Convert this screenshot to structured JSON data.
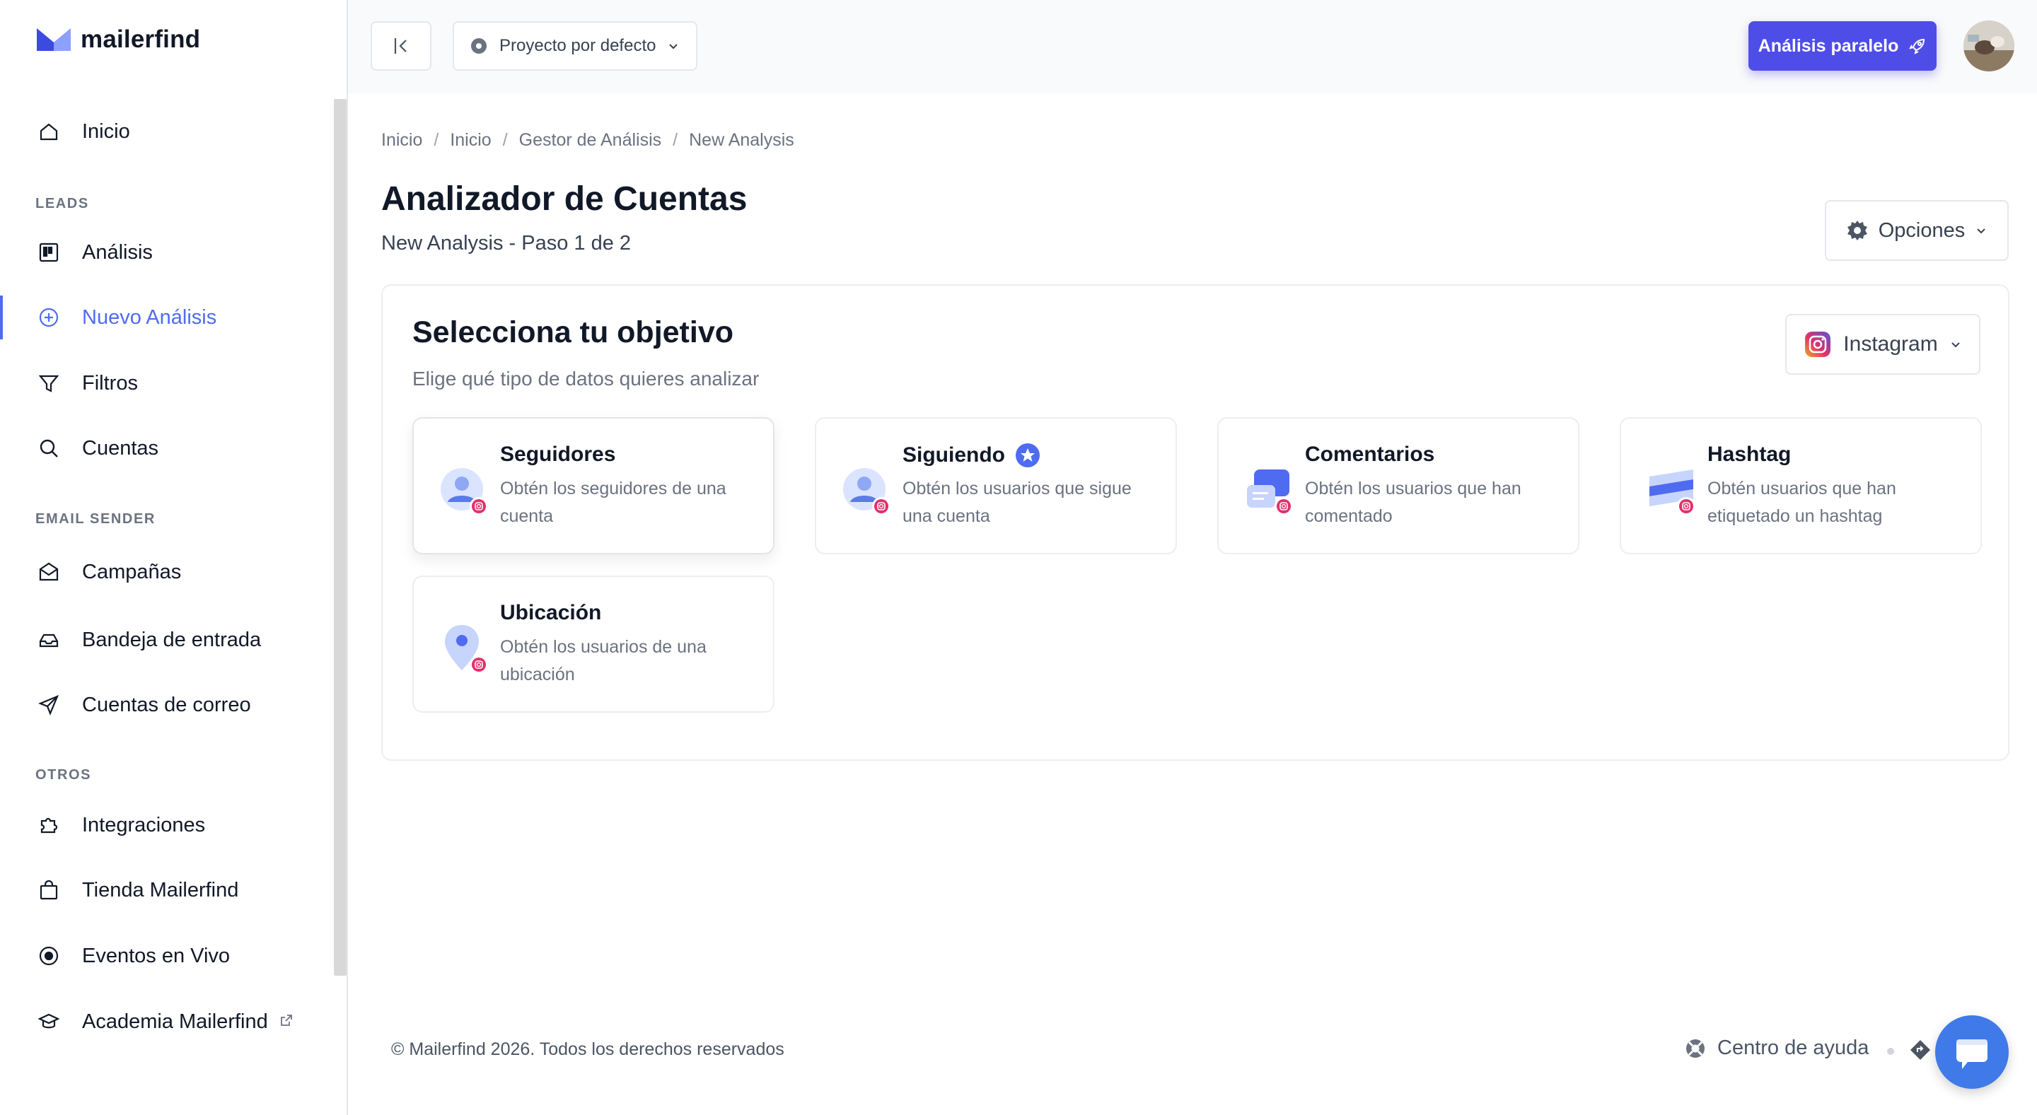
{
  "brand": {
    "name": "mailerfind"
  },
  "sidebar": {
    "items": [
      {
        "label": "Inicio",
        "icon": "home-icon"
      },
      {
        "label": "Análisis",
        "icon": "kanban-icon"
      },
      {
        "label": "Nuevo Análisis",
        "icon": "plus-circle-icon",
        "active": true
      },
      {
        "label": "Filtros",
        "icon": "filter-icon"
      },
      {
        "label": "Cuentas",
        "icon": "search-icon"
      },
      {
        "label": "Campañas",
        "icon": "envelope-icon"
      },
      {
        "label": "Bandeja de entrada",
        "icon": "inbox-icon"
      },
      {
        "label": "Cuentas de correo",
        "icon": "send-icon"
      },
      {
        "label": "Integraciones",
        "icon": "puzzle-icon"
      },
      {
        "label": "Tienda Mailerfind",
        "icon": "bag-icon"
      },
      {
        "label": "Eventos en Vivo",
        "icon": "record-icon"
      },
      {
        "label": "Academia Mailerfind",
        "icon": "graduation-cap-icon"
      }
    ],
    "sections": {
      "leads": "LEADS",
      "email_sender": "EMAIL SENDER",
      "otros": "OTROS"
    }
  },
  "header": {
    "project": "Proyecto por defecto",
    "parallel_button": "Análisis paralelo"
  },
  "breadcrumb": [
    "Inicio",
    "Inicio",
    "Gestor de Análisis",
    "New Analysis"
  ],
  "page": {
    "title": "Analizador de Cuentas",
    "subtitle": "New Analysis - Paso 1 de 2",
    "options_button": "Opciones"
  },
  "objective": {
    "title": "Selecciona tu objetivo",
    "subtitle": "Elige qué tipo de datos quieres analizar",
    "platform": "Instagram",
    "options": [
      {
        "title": "Seguidores",
        "desc": "Obtén los seguidores de una cuenta"
      },
      {
        "title": "Siguiendo",
        "desc": "Obtén los usuarios que sigue una cuenta"
      },
      {
        "title": "Comentarios",
        "desc": "Obtén los usuarios que han comentado"
      },
      {
        "title": "Hashtag",
        "desc": "Obtén usuarios que han etiquetado un hashtag"
      },
      {
        "title": "Ubicación",
        "desc": "Obtén los usuarios de una ubicación"
      }
    ]
  },
  "footer": {
    "copyright": "© Mailerfind 2026. Todos los derechos reservados",
    "help": "Centro de ayuda"
  },
  "colors": {
    "accent": "#4f6bf0",
    "primary_button": "#4f4de8",
    "chat": "#3f7ae8"
  }
}
